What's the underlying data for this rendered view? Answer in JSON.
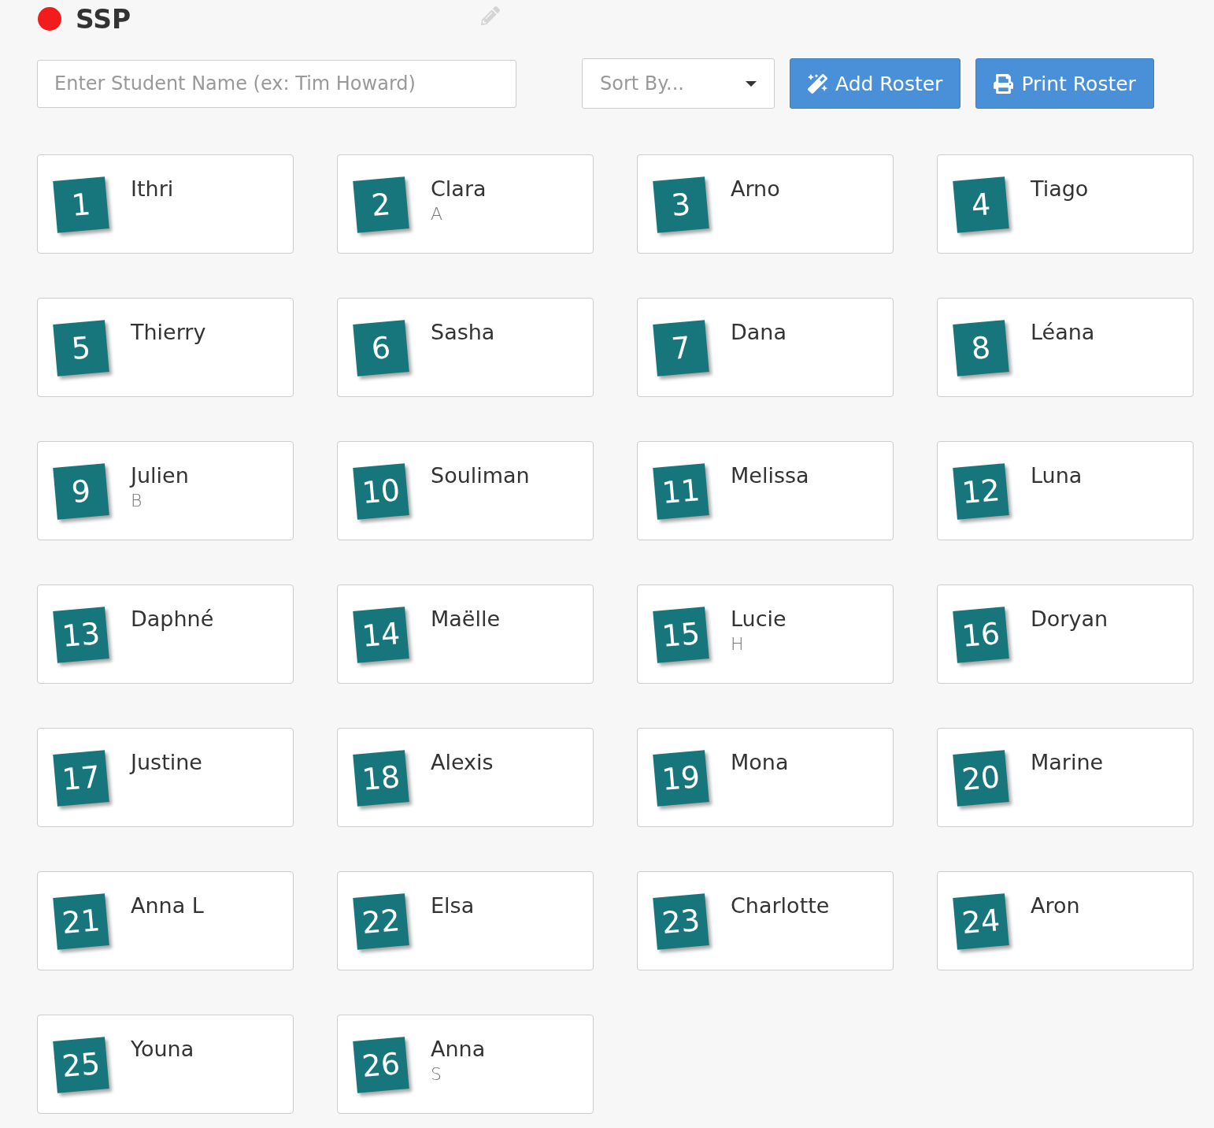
{
  "title": "SSP",
  "search": {
    "placeholder": "Enter Student Name (ex: Tim Howard)"
  },
  "sort": {
    "placeholder": "Sort By..."
  },
  "buttons": [
    {
      "kind": "add",
      "label": "Add Roster"
    },
    {
      "kind": "print",
      "label": "Print Roster"
    }
  ],
  "students": [
    {
      "number": "1",
      "name": "Ithri"
    },
    {
      "number": "2",
      "name": "Clara",
      "initial": "A"
    },
    {
      "number": "3",
      "name": "Arno"
    },
    {
      "number": "4",
      "name": "Tiago"
    },
    {
      "number": "5",
      "name": "Thierry"
    },
    {
      "number": "6",
      "name": "Sasha"
    },
    {
      "number": "7",
      "name": "Dana"
    },
    {
      "number": "8",
      "name": "Léana"
    },
    {
      "number": "9",
      "name": "Julien",
      "initial": "B"
    },
    {
      "number": "10",
      "name": "Souliman"
    },
    {
      "number": "11",
      "name": "Melissa"
    },
    {
      "number": "12",
      "name": "Luna"
    },
    {
      "number": "13",
      "name": "Daphné"
    },
    {
      "number": "14",
      "name": "Maëlle"
    },
    {
      "number": "15",
      "name": "Lucie",
      "initial": "H"
    },
    {
      "number": "16",
      "name": "Doryan"
    },
    {
      "number": "17",
      "name": "Justine"
    },
    {
      "number": "18",
      "name": "Alexis"
    },
    {
      "number": "19",
      "name": "Mona"
    },
    {
      "number": "20",
      "name": "Marine"
    },
    {
      "number": "21",
      "name": "Anna L"
    },
    {
      "number": "22",
      "name": "Elsa"
    },
    {
      "number": "23",
      "name": "Charlotte"
    },
    {
      "number": "24",
      "name": "Aron"
    },
    {
      "number": "25",
      "name": "Youna"
    },
    {
      "number": "26",
      "name": "Anna",
      "initial": "S"
    }
  ]
}
